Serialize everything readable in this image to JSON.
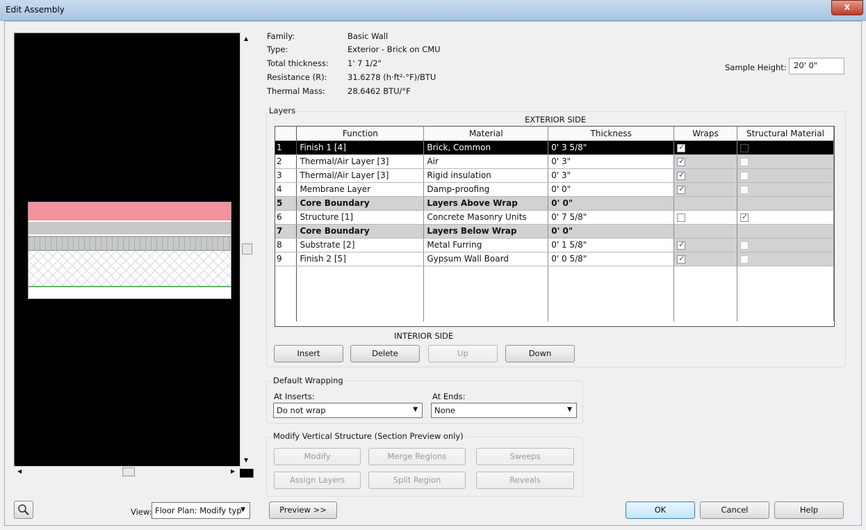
{
  "window": {
    "title": "Edit Assembly",
    "close": "x"
  },
  "info": [
    {
      "label": "Family:",
      "value": "Basic Wall"
    },
    {
      "label": "Type:",
      "value": "Exterior - Brick on CMU"
    },
    {
      "label": "Total thickness:",
      "value": "1'  7 1/2\""
    },
    {
      "label": "Resistance (R):",
      "value": "31.6278 (h·ft²·°F)/BTU"
    },
    {
      "label": "Thermal Mass:",
      "value": "28.6462 BTU/°F"
    }
  ],
  "sample_height": {
    "label": "Sample Height:",
    "value": "20'  0\""
  },
  "layers": {
    "group_title": "Layers",
    "exterior_label": "EXTERIOR SIDE",
    "interior_label": "INTERIOR SIDE",
    "columns": [
      "Function",
      "Material",
      "Thickness",
      "Wraps",
      "Structural Material"
    ],
    "rows": [
      {
        "n": "1",
        "function": "Finish 1 [4]",
        "material": "Brick, Common",
        "thickness": "0'  3 5/8\"",
        "wraps": "checked",
        "structural": "unchecked"
      },
      {
        "n": "2",
        "function": "Thermal/Air Layer [3]",
        "material": "Air",
        "thickness": "0'  3\"",
        "wraps": "checked",
        "structural": "unchecked"
      },
      {
        "n": "3",
        "function": "Thermal/Air Layer [3]",
        "material": "Rigid insulation",
        "thickness": "0'  3\"",
        "wraps": "checked",
        "structural": "unchecked"
      },
      {
        "n": "4",
        "function": "Membrane Layer",
        "material": "Damp-proofing",
        "thickness": "0'  0\"",
        "wraps": "checked",
        "structural": "unchecked"
      },
      {
        "n": "5",
        "function": "Core Boundary",
        "material": "Layers Above Wrap",
        "thickness": "0'  0\"",
        "wraps": "none",
        "structural": "none"
      },
      {
        "n": "6",
        "function": "Structure [1]",
        "material": "Concrete Masonry Units",
        "thickness": "0'  7 5/8\"",
        "wraps": "unchecked",
        "structural": "checked"
      },
      {
        "n": "7",
        "function": "Core Boundary",
        "material": "Layers Below Wrap",
        "thickness": "0'  0\"",
        "wraps": "none",
        "structural": "none"
      },
      {
        "n": "8",
        "function": "Substrate [2]",
        "material": "Metal Furring",
        "thickness": "0'  1 5/8\"",
        "wraps": "checked",
        "structural": "unchecked"
      },
      {
        "n": "9",
        "function": "Finish 2 [5]",
        "material": "Gypsum Wall Board",
        "thickness": "0'  0 5/8\"",
        "wraps": "checked",
        "structural": "unchecked"
      }
    ],
    "buttons": {
      "insert": "Insert",
      "delete": "Delete",
      "up": "Up",
      "down": "Down"
    }
  },
  "wrapping": {
    "title": "Default Wrapping",
    "at_inserts_label": "At Inserts:",
    "at_inserts_value": "Do not wrap",
    "at_ends_label": "At Ends:",
    "at_ends_value": "None"
  },
  "vertical": {
    "title": "Modify Vertical Structure (Section Preview only)",
    "modify": "Modify",
    "merge": "Merge Regions",
    "sweeps": "Sweeps",
    "assign": "Assign Layers",
    "split": "Split Region",
    "reveals": "Reveals"
  },
  "footer": {
    "view_label": "View:",
    "view_value": "Floor Plan: Modify typ",
    "preview": "Preview >>",
    "ok": "OK",
    "cancel": "Cancel",
    "help": "Help"
  }
}
